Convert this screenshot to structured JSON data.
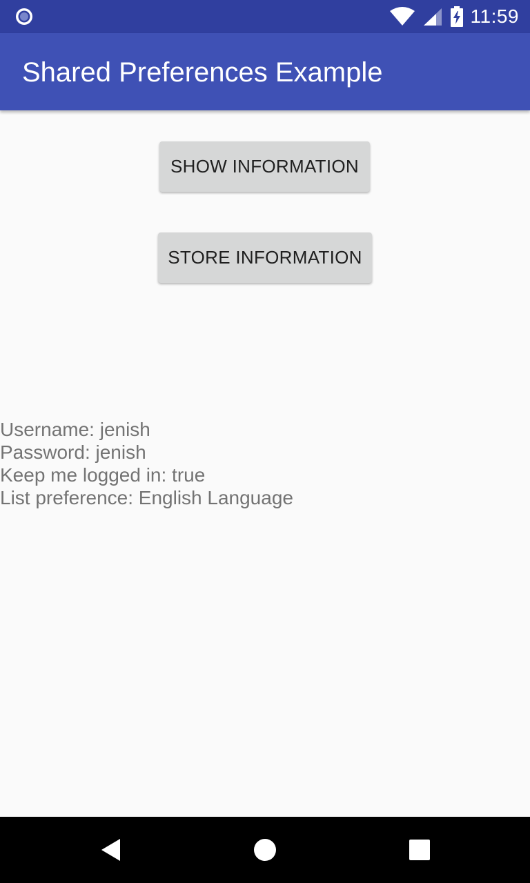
{
  "status_bar": {
    "time": "11:59",
    "left_icon": "notification-circle-icon",
    "right_icons": [
      "wifi-icon",
      "signal-icon",
      "battery-charging-icon"
    ],
    "background_color": "#303f9f"
  },
  "app_bar": {
    "title": "Shared Preferences Example",
    "background_color": "#3f51b5"
  },
  "buttons": {
    "show_label": "SHOW INFORMATION",
    "store_label": "STORE INFORMATION"
  },
  "info": {
    "lines": [
      "Username: jenish",
      "Password: jenish",
      "Keep me logged in: true",
      "List preference: English Language"
    ],
    "text_color": "#737373"
  },
  "nav_bar": {
    "icons": [
      "back-icon",
      "home-icon",
      "recents-icon"
    ]
  }
}
